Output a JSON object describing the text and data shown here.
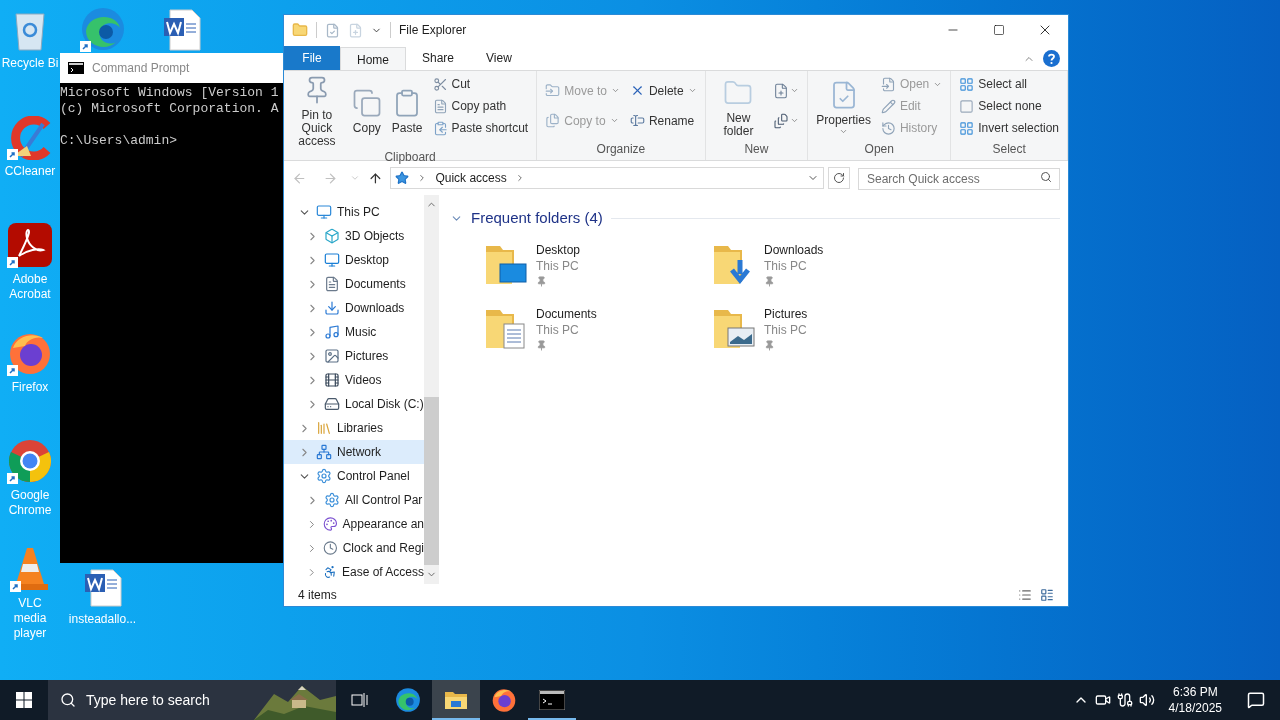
{
  "desktop_icons": [
    {
      "label": "Recycle Bi",
      "shortcut": false
    },
    {
      "shortcut": true
    },
    {
      "shortcut": false
    },
    {
      "label": "CCleaner",
      "shortcut": true
    },
    {
      "label": "Adobe Acrobat",
      "shortcut": true
    },
    {
      "label": "Firefox",
      "shortcut": true
    },
    {
      "label": "Google Chrome",
      "shortcut": true
    },
    {
      "label": "VLC media player",
      "shortcut": true
    },
    {
      "label": "insteadallo...",
      "shortcut": false
    }
  ],
  "cmd_window": {
    "title": "Command Prompt",
    "output": [
      "Microsoft Windows [Version 1",
      "(c) Microsoft Corporation. A"
    ],
    "prompt": "C:\\Users\\admin>"
  },
  "explorer": {
    "title": "File Explorer",
    "ribbon_tabs": [
      {
        "label": "File",
        "kind": "file",
        "selected": false
      },
      {
        "label": "Home",
        "kind": "tab",
        "selected": true
      },
      {
        "label": "Share",
        "kind": "tab",
        "selected": false
      },
      {
        "label": "View",
        "kind": "tab",
        "selected": false
      }
    ],
    "ribbon_groups": [
      {
        "label": "Clipboard",
        "columns": [
          [
            {
              "kind": "large",
              "label": "Pin to Quick access",
              "disabled": false,
              "dropdown": false
            }
          ],
          [
            {
              "kind": "large",
              "label": "Copy",
              "disabled": false,
              "dropdown": false
            }
          ],
          [
            {
              "kind": "large",
              "label": "Paste",
              "disabled": false,
              "dropdown": false
            }
          ],
          [
            {
              "kind": "small",
              "label": "Cut",
              "disabled": false,
              "dropdown": false
            },
            {
              "kind": "small",
              "label": "Copy path",
              "disabled": false,
              "dropdown": false
            },
            {
              "kind": "small",
              "label": "Paste shortcut",
              "disabled": false,
              "dropdown": false
            }
          ]
        ]
      },
      {
        "label": "Organize",
        "columns": [
          [
            {
              "kind": "small",
              "label": "Move to",
              "disabled": true,
              "dropdown": true
            },
            {
              "kind": "small",
              "label": "Copy to",
              "disabled": true,
              "dropdown": true
            }
          ],
          [
            {
              "kind": "small",
              "label": "Delete",
              "disabled": false,
              "dropdown": true
            },
            {
              "kind": "small",
              "label": "Rename",
              "disabled": false,
              "dropdown": false
            }
          ]
        ]
      },
      {
        "label": "New",
        "columns": [
          [
            {
              "kind": "large",
              "label": "New folder",
              "disabled": false,
              "dropdown": false
            }
          ],
          [
            {
              "kind": "icon",
              "disabled": false,
              "dropdown": true
            },
            {
              "kind": "icon",
              "disabled": false,
              "dropdown": true
            }
          ]
        ]
      },
      {
        "label": "Open",
        "columns": [
          [
            {
              "kind": "large",
              "label": "Properties",
              "disabled": false,
              "dropdown": true
            }
          ],
          [
            {
              "kind": "small",
              "label": "Open",
              "disabled": true,
              "dropdown": true
            },
            {
              "kind": "small",
              "label": "Edit",
              "disabled": true,
              "dropdown": false
            },
            {
              "kind": "small",
              "label": "History",
              "disabled": true,
              "dropdown": false
            }
          ]
        ]
      },
      {
        "label": "Select",
        "columns": [
          [
            {
              "kind": "small",
              "label": "Select all",
              "disabled": false,
              "dropdown": false
            },
            {
              "kind": "small",
              "label": "Select none",
              "disabled": false,
              "dropdown": false
            },
            {
              "kind": "small",
              "label": "Invert selection",
              "disabled": false,
              "dropdown": false
            }
          ]
        ]
      }
    ],
    "address": {
      "path": [
        "Quick access"
      ]
    },
    "search": {
      "placeholder": "Search Quick access"
    },
    "nav_tree": [
      {
        "label": "This PC",
        "expanded": true,
        "selected": false,
        "children": [
          {
            "label": "3D Objects",
            "expanded": false,
            "selected": false
          },
          {
            "label": "Desktop",
            "expanded": false,
            "selected": false
          },
          {
            "label": "Documents",
            "expanded": false,
            "selected": false
          },
          {
            "label": "Downloads",
            "expanded": false,
            "selected": false
          },
          {
            "label": "Music",
            "expanded": false,
            "selected": false
          },
          {
            "label": "Pictures",
            "expanded": false,
            "selected": false
          },
          {
            "label": "Videos",
            "expanded": false,
            "selected": false
          },
          {
            "label": "Local Disk (C:)",
            "expanded": false,
            "selected": false
          }
        ]
      },
      {
        "label": "Libraries",
        "expanded": false,
        "selected": false
      },
      {
        "label": "Network",
        "expanded": false,
        "selected": true
      },
      {
        "label": "Control Panel",
        "expanded": true,
        "selected": false,
        "children": [
          {
            "label": "All Control Par",
            "expanded": false,
            "selected": false
          },
          {
            "label": "Appearance an",
            "expanded": false,
            "selected": false
          },
          {
            "label": "Clock and Regi",
            "expanded": false,
            "selected": false
          },
          {
            "label": "Ease of Access",
            "expanded": false,
            "selected": false
          }
        ]
      }
    ],
    "section": {
      "title": "Frequent folders (4)",
      "expanded": true,
      "items": [
        {
          "name": "Desktop",
          "location": "This PC",
          "pinned": true
        },
        {
          "name": "Downloads",
          "location": "This PC",
          "pinned": true
        },
        {
          "name": "Documents",
          "location": "This PC",
          "pinned": true
        },
        {
          "name": "Pictures",
          "location": "This PC",
          "pinned": true
        }
      ]
    },
    "status": "4 items"
  },
  "taskbar": {
    "search": {
      "placeholder": "Type here to search"
    },
    "apps": [
      {
        "selected": false,
        "running": false
      },
      {
        "selected": true,
        "running": true
      },
      {
        "selected": false,
        "running": false
      },
      {
        "selected": false,
        "running": true
      }
    ],
    "time": "6:36 PM",
    "date": "4/18/2025"
  }
}
